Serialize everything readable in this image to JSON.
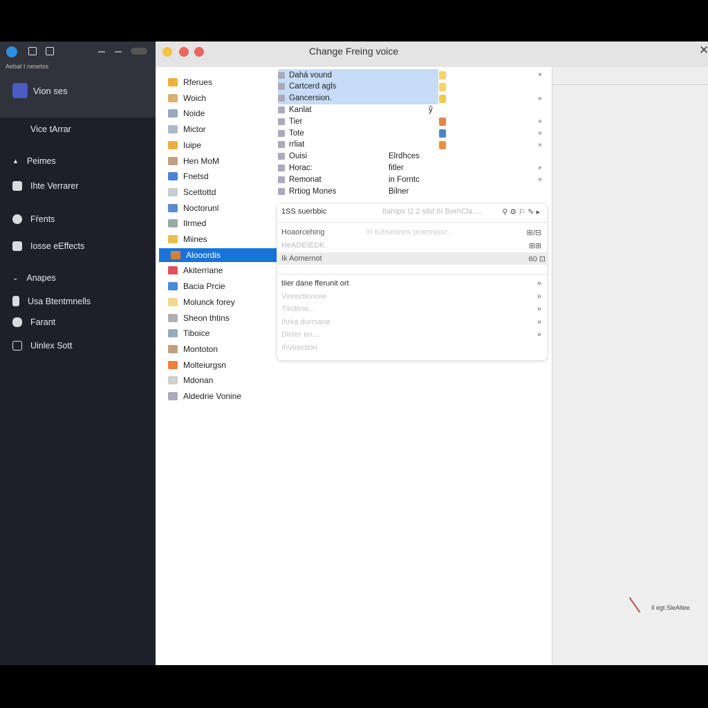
{
  "sidebar": {
    "app_label": "Aebat t nesetss",
    "header_item": "Vion ses",
    "items": [
      {
        "label": "Vice tArrar",
        "icon": "none"
      },
      {
        "label": "Peimes",
        "icon": "chevron-up-icon"
      },
      {
        "label": "Ihte Verrarer",
        "icon": "cloud-icon"
      },
      {
        "label": "Fŕents",
        "icon": "globe-icon"
      },
      {
        "label": "Iosse eEffects",
        "icon": "stack-icon"
      },
      {
        "label": "Anapes",
        "icon": "chevron-down-icon"
      },
      {
        "label": "Usa Btentmnells",
        "icon": "phone-icon"
      },
      {
        "label": "Farant",
        "icon": "circle-icon"
      },
      {
        "label": "Uinlex Sott",
        "icon": "window-icon"
      }
    ]
  },
  "window": {
    "title": "Change Freing voice"
  },
  "list": {
    "items": [
      "Rferues",
      "Woich",
      "Noide",
      "Mictor",
      "Iuipe",
      "Hen MoM",
      "Fnetsd",
      "Scettottd",
      "Noctorunl",
      "Ilrmed",
      "Miines",
      "Alooordis",
      "Akiterriane",
      "Bacia Prcie",
      "Molunck forey",
      "Sheon thtins",
      "Tiboice",
      "Montoton",
      "Molteiurgsn",
      "Mdonan",
      "Aldedrie Vonine"
    ],
    "selected": "Alooordis"
  },
  "menu": {
    "items": [
      {
        "label": "Dahá vound",
        "swatch": "#f3d36a",
        "highlight": true,
        "arrow": "×"
      },
      {
        "label": "Cartcerd agls",
        "swatch": "#f3d36a",
        "highlight": true,
        "arrow": ""
      },
      {
        "label": "Gancersion.",
        "swatch": "#f0c94e",
        "highlight": true,
        "arrow": "»"
      },
      {
        "label": "Kanlat",
        "swatch": "",
        "extra": "ŷ",
        "arrow": ""
      },
      {
        "label": "Tier",
        "swatch": "#e8834a",
        "arrow": "»"
      },
      {
        "label": "Tote",
        "swatch": "#4b87c0",
        "arrow": "»"
      },
      {
        "label": "rrliat",
        "swatch": "#e8904a",
        "arrow": "»"
      },
      {
        "label": "Ouisi",
        "extra": "Elrdhces",
        "arrow": ""
      },
      {
        "label": "Horac:",
        "extra": "fitler",
        "arrow": "»"
      },
      {
        "label": "Remonat",
        "extra": "in Forntc",
        "arrow": "»"
      },
      {
        "label": "Rrtiog Mones",
        "extra": "Bilner",
        "arrow": ""
      }
    ]
  },
  "popup": {
    "header_left": "1SS suerbbic",
    "header_mid": "Itamps I2 2 s6d 6I BerhCla.....",
    "section1": [
      {
        "label": "Hoaorcehing",
        "hint": "Xl tUhsebnns pramnpisr...",
        "right": "⊞/⊟"
      },
      {
        "label": "HeADEIEDK",
        "hint": "",
        "right": "⊞⊞"
      },
      {
        "label": "Ik Aomernot",
        "hint": "",
        "right": "60 ⊡",
        "highlight": true
      }
    ],
    "section2": [
      {
        "label": "tiier dane fferunit ort",
        "arrow": "»",
        "dim": false
      },
      {
        "label": "Vinrectionore",
        "arrow": "»",
        "dim": true
      },
      {
        "label": "Tlirdtine...",
        "arrow": "»",
        "dim": true
      },
      {
        "label": "Ihrka durmane",
        "arrow": "»",
        "dim": true
      },
      {
        "label": "Dinter en....",
        "arrow": "»",
        "dim": true
      },
      {
        "label": "IhVirection",
        "arrow": "",
        "dim": true
      }
    ]
  },
  "status": {
    "text": "Il egt SleAltee"
  },
  "colors": {
    "accent": "#1a73d9",
    "highlight": "#c6dcf7",
    "sidebar": "#1d2029"
  }
}
